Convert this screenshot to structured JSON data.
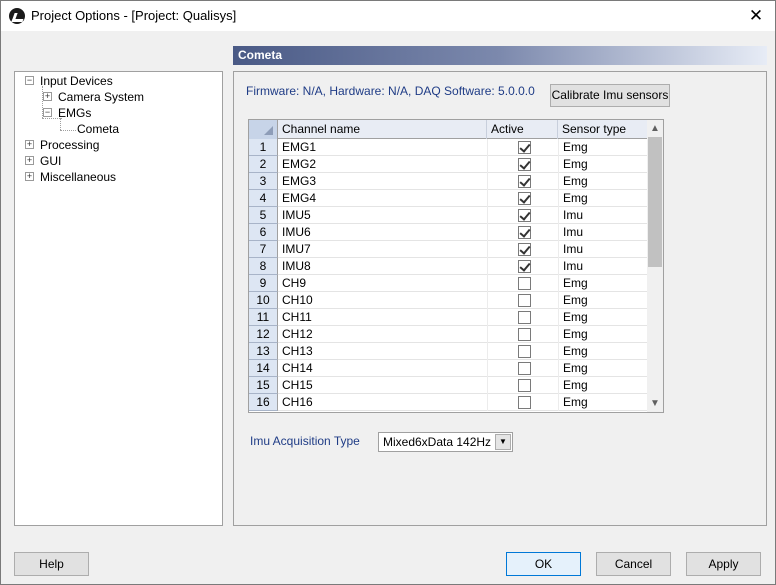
{
  "window": {
    "title": "Project Options - [Project: Qualisys]",
    "close_label": "✕"
  },
  "tree": {
    "items": [
      {
        "label": "Input Devices",
        "level": 0,
        "toggle": "−"
      },
      {
        "label": "Camera System",
        "level": 1,
        "toggle": "+"
      },
      {
        "label": "EMGs",
        "level": 1,
        "toggle": "−"
      },
      {
        "label": "Cometa",
        "level": 2,
        "toggle": ""
      },
      {
        "label": "Processing",
        "level": 0,
        "toggle": "+"
      },
      {
        "label": "GUI",
        "level": 0,
        "toggle": "+"
      },
      {
        "label": "Miscellaneous",
        "level": 0,
        "toggle": "+"
      }
    ],
    "selected": "Cometa"
  },
  "panel": {
    "header": "Cometa",
    "firmware_text": "Firmware: N/A, Hardware: N/A, DAQ Software: 5.0.0.0",
    "calibrate_label": "Calibrate Imu sensors"
  },
  "grid": {
    "columns": [
      "Channel name",
      "Active",
      "Sensor type"
    ],
    "rows": [
      {
        "num": "1",
        "name": "EMG1",
        "active": true,
        "type": "Emg"
      },
      {
        "num": "2",
        "name": "EMG2",
        "active": true,
        "type": "Emg"
      },
      {
        "num": "3",
        "name": "EMG3",
        "active": true,
        "type": "Emg"
      },
      {
        "num": "4",
        "name": "EMG4",
        "active": true,
        "type": "Emg"
      },
      {
        "num": "5",
        "name": "IMU5",
        "active": true,
        "type": "Imu"
      },
      {
        "num": "6",
        "name": "IMU6",
        "active": true,
        "type": "Imu"
      },
      {
        "num": "7",
        "name": "IMU7",
        "active": true,
        "type": "Imu"
      },
      {
        "num": "8",
        "name": "IMU8",
        "active": true,
        "type": "Imu"
      },
      {
        "num": "9",
        "name": "CH9",
        "active": false,
        "type": "Emg"
      },
      {
        "num": "10",
        "name": "CH10",
        "active": false,
        "type": "Emg"
      },
      {
        "num": "11",
        "name": "CH11",
        "active": false,
        "type": "Emg"
      },
      {
        "num": "12",
        "name": "CH12",
        "active": false,
        "type": "Emg"
      },
      {
        "num": "13",
        "name": "CH13",
        "active": false,
        "type": "Emg"
      },
      {
        "num": "14",
        "name": "CH14",
        "active": false,
        "type": "Emg"
      },
      {
        "num": "15",
        "name": "CH15",
        "active": false,
        "type": "Emg"
      },
      {
        "num": "16",
        "name": "CH16",
        "active": false,
        "type": "Emg"
      }
    ]
  },
  "acquisition": {
    "label": "Imu Acquisition Type",
    "value": "Mixed6xData 142Hz"
  },
  "buttons": {
    "help": "Help",
    "ok": "OK",
    "cancel": "Cancel",
    "apply": "Apply"
  }
}
